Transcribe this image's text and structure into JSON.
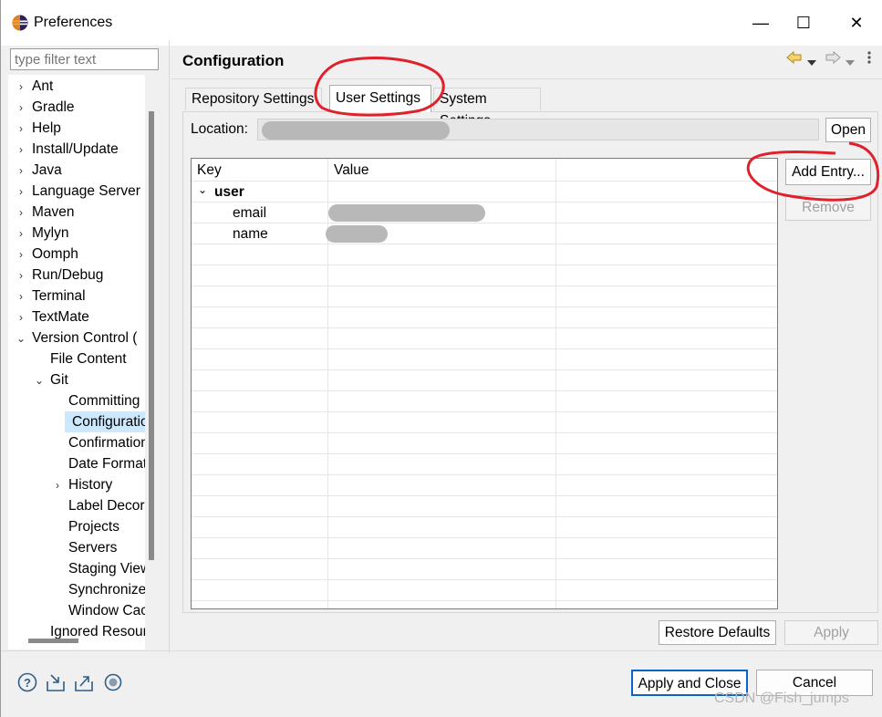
{
  "window": {
    "title": "Preferences",
    "minimize": "—",
    "maximize": "☐",
    "close": "✕"
  },
  "filter": {
    "placeholder": "type filter text"
  },
  "tree": [
    {
      "label": "Ant",
      "indent": 0,
      "exp": "›"
    },
    {
      "label": "Gradle",
      "indent": 0,
      "exp": "›"
    },
    {
      "label": "Help",
      "indent": 0,
      "exp": "›"
    },
    {
      "label": "Install/Update",
      "indent": 0,
      "exp": "›"
    },
    {
      "label": "Java",
      "indent": 0,
      "exp": "›"
    },
    {
      "label": "Language Server",
      "indent": 0,
      "exp": "›"
    },
    {
      "label": "Maven",
      "indent": 0,
      "exp": "›"
    },
    {
      "label": "Mylyn",
      "indent": 0,
      "exp": "›"
    },
    {
      "label": "Oomph",
      "indent": 0,
      "exp": "›"
    },
    {
      "label": "Run/Debug",
      "indent": 0,
      "exp": "›"
    },
    {
      "label": "Terminal",
      "indent": 0,
      "exp": "›"
    },
    {
      "label": "TextMate",
      "indent": 0,
      "exp": "›"
    },
    {
      "label": "Version Control (",
      "indent": 0,
      "exp": "⌄"
    },
    {
      "label": "File Content",
      "indent": 1,
      "exp": ""
    },
    {
      "label": "Git",
      "indent": 1,
      "exp": "⌄"
    },
    {
      "label": "Committing",
      "indent": 2,
      "exp": ""
    },
    {
      "label": "Configuration",
      "indent": 2,
      "exp": "",
      "selected": true
    },
    {
      "label": "Confirmations",
      "indent": 2,
      "exp": ""
    },
    {
      "label": "Date Format",
      "indent": 2,
      "exp": ""
    },
    {
      "label": "History",
      "indent": 2,
      "exp": "›"
    },
    {
      "label": "Label Decorations",
      "indent": 2,
      "exp": ""
    },
    {
      "label": "Projects",
      "indent": 2,
      "exp": ""
    },
    {
      "label": "Servers",
      "indent": 2,
      "exp": ""
    },
    {
      "label": "Staging View",
      "indent": 2,
      "exp": ""
    },
    {
      "label": "Synchronize",
      "indent": 2,
      "exp": ""
    },
    {
      "label": "Window Cache",
      "indent": 2,
      "exp": ""
    },
    {
      "label": "Ignored Resources",
      "indent": 1,
      "exp": ""
    }
  ],
  "page": {
    "title": "Configuration",
    "back_icon": "back-arrow-icon",
    "forward_icon": "forward-arrow-icon",
    "menu_icon": "view-menu-icon"
  },
  "tabs": [
    {
      "label": "Repository Settings"
    },
    {
      "label": "User Settings",
      "active": true
    },
    {
      "label": "System Settings"
    }
  ],
  "location": {
    "label": "Location:",
    "open": "Open"
  },
  "table": {
    "headers": [
      "Key",
      "Value"
    ],
    "rows": [
      {
        "key": "user",
        "section": true
      },
      {
        "key": "email"
      },
      {
        "key": "name"
      }
    ]
  },
  "side_buttons": {
    "add": "Add Entry...",
    "remove": "Remove"
  },
  "page_buttons": {
    "restore": "Restore Defaults",
    "apply": "Apply"
  },
  "footer": {
    "apply_close": "Apply and Close",
    "cancel": "Cancel",
    "watermark": "CSDN @Fish_jumps"
  },
  "colors": {
    "selection": "#cce8ff",
    "annotation": "#e0202a",
    "accent": "#0a64c8"
  }
}
